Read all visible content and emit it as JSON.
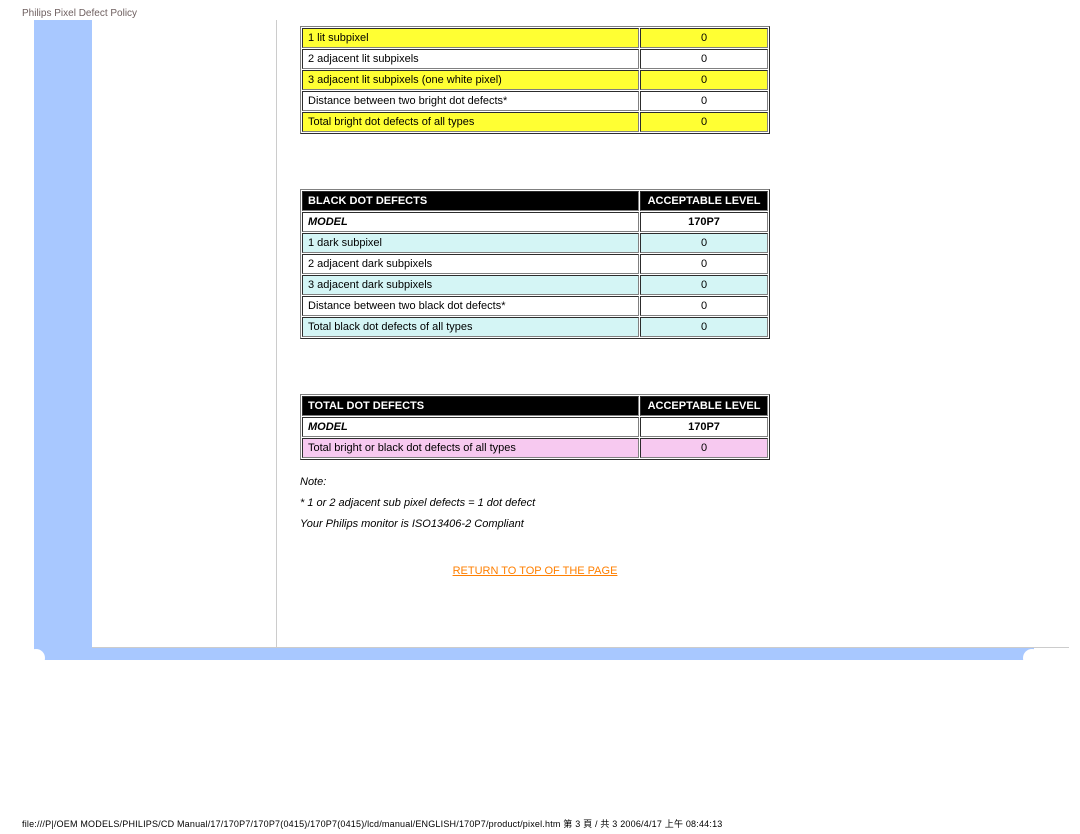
{
  "page_title": "Philips Pixel Defect Policy",
  "table1": {
    "rows": [
      {
        "label": "1 lit subpixel",
        "value": "0",
        "cls": "y"
      },
      {
        "label": "2 adjacent lit subpixels",
        "value": "0",
        "cls": "w"
      },
      {
        "label": "3 adjacent lit subpixels (one white pixel)",
        "value": "0",
        "cls": "y"
      },
      {
        "label": "Distance between two bright dot defects*",
        "value": "0",
        "cls": "w"
      },
      {
        "label": "Total bright dot defects of all types",
        "value": "0",
        "cls": "y"
      }
    ]
  },
  "table2": {
    "header_left": "BLACK DOT DEFECTS",
    "header_right": "ACCEPTABLE LEVEL",
    "model_label": "MODEL",
    "model_value": "170P7",
    "rows": [
      {
        "label": "1 dark subpixel",
        "value": "0",
        "cls": "c"
      },
      {
        "label": "2 adjacent dark subpixels",
        "value": "0",
        "cls": "w"
      },
      {
        "label": "3 adjacent dark subpixels",
        "value": "0",
        "cls": "c"
      },
      {
        "label": "Distance between two black dot defects*",
        "value": "0",
        "cls": "w"
      },
      {
        "label": "Total black dot defects of all types",
        "value": "0",
        "cls": "c"
      }
    ]
  },
  "table3": {
    "header_left": "TOTAL DOT DEFECTS",
    "header_right": "ACCEPTABLE LEVEL",
    "model_label": "MODEL",
    "model_value": "170P7",
    "rows": [
      {
        "label": "Total bright or black dot defects of all types",
        "value": "0",
        "cls": "p"
      }
    ]
  },
  "notes": {
    "line1": "Note:",
    "line2": "* 1 or 2 adjacent sub pixel defects = 1 dot defect",
    "line3": "Your Philips monitor is ISO13406-2 Compliant"
  },
  "return_link": "RETURN TO TOP OF THE PAGE",
  "footer": "file:///P|/OEM MODELS/PHILIPS/CD Manual/17/170P7/170P7(0415)/170P7(0415)/lcd/manual/ENGLISH/170P7/product/pixel.htm 第 3 頁 / 共 3 2006/4/17 上午 08:44:13"
}
